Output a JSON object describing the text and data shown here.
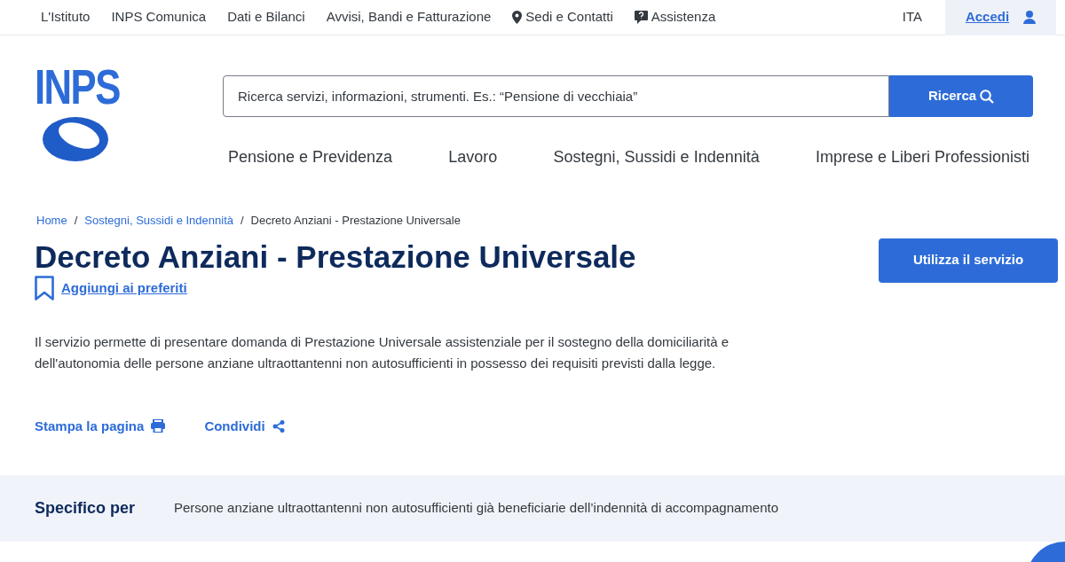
{
  "top_links": [
    {
      "label": "L'Istituto",
      "kind": "plain"
    },
    {
      "label": "INPS Comunica",
      "kind": "plain"
    },
    {
      "label": "Dati e Bilanci",
      "kind": "plain"
    },
    {
      "label": "Avvisi, Bandi e Fatturazione",
      "kind": "plain"
    },
    {
      "label": "Sedi e Contatti",
      "kind": "location"
    },
    {
      "label": "Assistenza",
      "kind": "help"
    }
  ],
  "language": "ITA",
  "login": "Accedi",
  "logo": {
    "text": "INPS"
  },
  "search": {
    "placeholder": "Ricerca servizi, informazioni, strumenti. Es.: “Pensione di vecchiaia”",
    "button": "Ricerca"
  },
  "main_nav": [
    "Pensione e Previdenza",
    "Lavoro",
    "Sostegni, Sussidi e Indennità",
    "Imprese e Liberi Professionisti"
  ],
  "breadcrumb": [
    {
      "label": "Home",
      "kind": "link"
    },
    {
      "label": "Sostegni, Sussidi e Indennità",
      "kind": "link",
      "separator": "/"
    },
    {
      "label": "Decreto Anziani - Prestazione Universale",
      "kind": "current",
      "separator": "/"
    }
  ],
  "title": "Decreto Anziani - Prestazione Universale",
  "favorite": {
    "label": "Aggiungi ai preferiti"
  },
  "service_button": "Utilizza il servizio",
  "description": "Il servizio permette di presentare domanda di Prestazione Universale assistenziale per il sostegno della domiciliarità e dell'autonomia delle persone anziane ultraottantenni non autosufficienti in possesso dei requisiti previsti dalla legge.",
  "actions": [
    {
      "label": "Stampa la pagina",
      "kind": "print"
    },
    {
      "label": "Condividi",
      "kind": "share"
    }
  ],
  "specific_for": {
    "label": "Specifico per",
    "text": "Persone anziane ultraottantenni non autosufficienti già beneficiarie dell’indennità di accompagnamento"
  }
}
